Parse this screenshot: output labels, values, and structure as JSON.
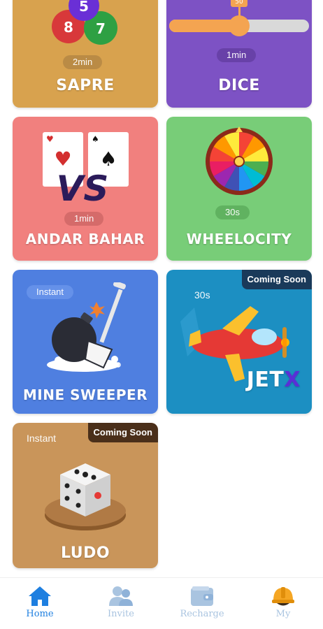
{
  "colors": {
    "sapre": "#d8a24e",
    "dice": "#7d52c4",
    "andar_bahar": "#f1807e",
    "wheelocity": "#78cd78",
    "mine_sweeper": "#4f7fe0",
    "jetx": "#1c8fc2",
    "ludo": "#c9955a",
    "nav_active": "#1e7fe0",
    "nav_inactive": "#a9c4e0"
  },
  "games": [
    {
      "id": "sapre",
      "title": "SAPRE",
      "timer": "2min",
      "balls": [
        "5",
        "8",
        "7"
      ]
    },
    {
      "id": "dice",
      "title": "DICE",
      "timer": "1min",
      "slider_value": "50"
    },
    {
      "id": "andar_bahar",
      "title": "ANDAR BAHAR",
      "timer": "1min"
    },
    {
      "id": "wheelocity",
      "title": "WHEELOCITY",
      "timer": "30s"
    },
    {
      "id": "mine_sweeper",
      "title": "MINE SWEEPER",
      "timer": "Instant"
    },
    {
      "id": "jetx",
      "title": "JET",
      "title_accent": "X",
      "timer": "30s",
      "badge": "Coming Soon"
    },
    {
      "id": "ludo",
      "title": "LUDO",
      "timer": "Instant",
      "badge": "Coming Soon"
    }
  ],
  "nav": [
    {
      "label": "Home",
      "icon": "home-icon",
      "active": true
    },
    {
      "label": "Invite",
      "icon": "invite-icon",
      "active": false
    },
    {
      "label": "Recharge",
      "icon": "wallet-icon",
      "active": false
    },
    {
      "label": "My",
      "icon": "helmet-icon",
      "active": false
    }
  ]
}
